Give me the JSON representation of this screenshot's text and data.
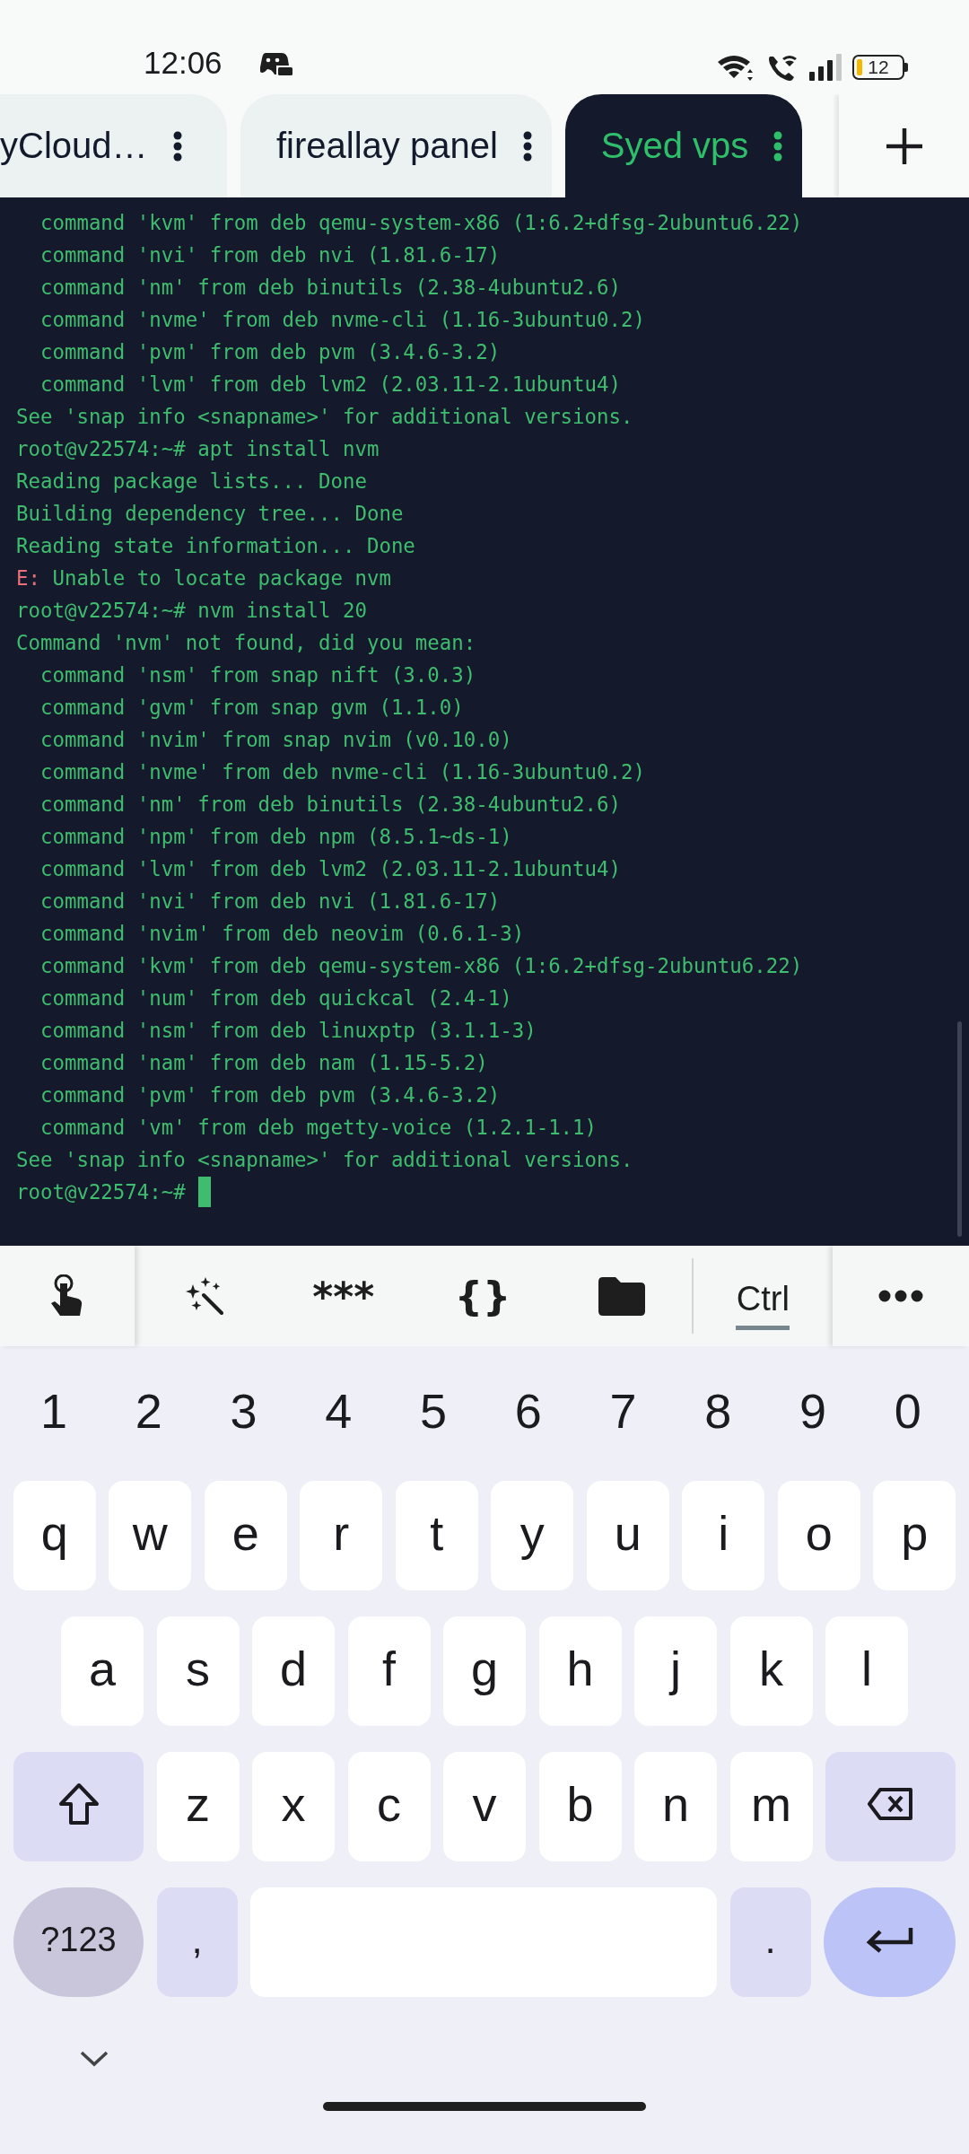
{
  "status_bar": {
    "time": "12:06",
    "battery": "12"
  },
  "tabs": [
    {
      "label": "yCloud…",
      "selected": false
    },
    {
      "label": "fireallay panel",
      "selected": false
    },
    {
      "label": "Syed vps",
      "selected": true
    }
  ],
  "terminal": {
    "lines": [
      {
        "kind": "output",
        "text": "  command 'kvm' from deb qemu-system-x86 (1:6.2+dfsg-2ubuntu6.22)"
      },
      {
        "kind": "output",
        "text": "  command 'nvi' from deb nvi (1.81.6-17)"
      },
      {
        "kind": "output",
        "text": "  command 'nm' from deb binutils (2.38-4ubuntu2.6)"
      },
      {
        "kind": "output",
        "text": "  command 'nvme' from deb nvme-cli (1.16-3ubuntu0.2)"
      },
      {
        "kind": "output",
        "text": "  command 'pvm' from deb pvm (3.4.6-3.2)"
      },
      {
        "kind": "output",
        "text": "  command 'lvm' from deb lvm2 (2.03.11-2.1ubuntu4)"
      },
      {
        "kind": "output",
        "text": "See 'snap info <snapname>' for additional versions."
      },
      {
        "kind": "output",
        "text": "root@v22574:~# apt install nvm"
      },
      {
        "kind": "output",
        "text": "Reading package lists... Done"
      },
      {
        "kind": "output",
        "text": "Building dependency tree... Done"
      },
      {
        "kind": "output",
        "text": "Reading state information... Done"
      },
      {
        "kind": "error",
        "tag": "E:",
        "text": " Unable to locate package nvm"
      },
      {
        "kind": "output",
        "text": "root@v22574:~# nvm install 20"
      },
      {
        "kind": "output",
        "text": "Command 'nvm' not found, did you mean:"
      },
      {
        "kind": "output",
        "text": "  command 'nsm' from snap nift (3.0.3)"
      },
      {
        "kind": "output",
        "text": "  command 'gvm' from snap gvm (1.1.0)"
      },
      {
        "kind": "output",
        "text": "  command 'nvim' from snap nvim (v0.10.0)"
      },
      {
        "kind": "output",
        "text": "  command 'nvme' from deb nvme-cli (1.16-3ubuntu0.2)"
      },
      {
        "kind": "output",
        "text": "  command 'nm' from deb binutils (2.38-4ubuntu2.6)"
      },
      {
        "kind": "output",
        "text": "  command 'npm' from deb npm (8.5.1~ds-1)"
      },
      {
        "kind": "output",
        "text": "  command 'lvm' from deb lvm2 (2.03.11-2.1ubuntu4)"
      },
      {
        "kind": "output",
        "text": "  command 'nvi' from deb nvi (1.81.6-17)"
      },
      {
        "kind": "output",
        "text": "  command 'nvim' from deb neovim (0.6.1-3)"
      },
      {
        "kind": "output",
        "text": "  command 'kvm' from deb qemu-system-x86 (1:6.2+dfsg-2ubuntu6.22)"
      },
      {
        "kind": "output",
        "text": "  command 'num' from deb quickcal (2.4-1)"
      },
      {
        "kind": "output",
        "text": "  command 'nsm' from deb linuxptp (3.1.1-3)"
      },
      {
        "kind": "output",
        "text": "  command 'nam' from deb nam (1.15-5.2)"
      },
      {
        "kind": "output",
        "text": "  command 'pvm' from deb pvm (3.4.6-3.2)"
      },
      {
        "kind": "output",
        "text": "  command 'vm' from deb mgetty-voice (1.2.1-1.1)"
      },
      {
        "kind": "output",
        "text": "See 'snap info <snapname>' for additional versions."
      },
      {
        "kind": "output",
        "text": "root@v22574:~#",
        "cursor": true
      }
    ]
  },
  "toolbar": {
    "keys": [
      {
        "kind": "touch"
      },
      {
        "kind": "wand"
      },
      {
        "kind": "text",
        "label": "***"
      },
      {
        "kind": "text",
        "label": "{}"
      },
      {
        "kind": "folder"
      },
      {
        "kind": "modifier",
        "label": "Ctrl",
        "active": true
      },
      {
        "kind": "more"
      }
    ]
  },
  "keyboard": {
    "number_row": [
      "1",
      "2",
      "3",
      "4",
      "5",
      "6",
      "7",
      "8",
      "9",
      "0"
    ],
    "letter_rows": [
      [
        "q",
        "w",
        "e",
        "r",
        "t",
        "y",
        "u",
        "i",
        "o",
        "p"
      ],
      [
        "a",
        "s",
        "d",
        "f",
        "g",
        "h",
        "j",
        "k",
        "l"
      ],
      [
        "z",
        "x",
        "c",
        "v",
        "b",
        "n",
        "m"
      ]
    ],
    "symbols_key": "?123",
    "comma_key": ",",
    "period_key": "."
  }
}
